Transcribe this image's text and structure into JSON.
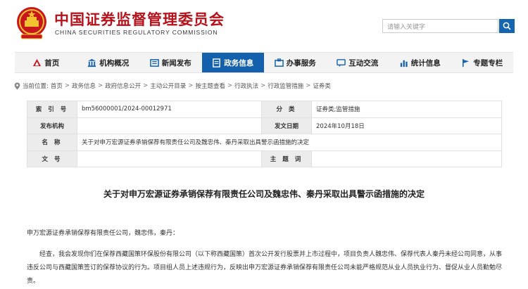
{
  "header": {
    "title": "中国证券监督管理委员会",
    "subtitle": "CHINA SECURITIES REGULATORY COMMISSION",
    "search_placeholder": "请输入关键字"
  },
  "nav": [
    {
      "label": "首页",
      "icon": "home-icon"
    },
    {
      "label": "机构概况",
      "icon": "building-icon"
    },
    {
      "label": "新闻发布",
      "icon": "news-icon"
    },
    {
      "label": "政务信息",
      "icon": "document-icon"
    },
    {
      "label": "办事服务",
      "icon": "service-icon"
    },
    {
      "label": "互动交流",
      "icon": "chat-icon"
    },
    {
      "label": "统计信息",
      "icon": "stats-icon"
    },
    {
      "label": "专题专栏",
      "icon": "flag-icon"
    }
  ],
  "breadcrumb": {
    "prefix": "当前位置:",
    "items": [
      "首页",
      "政务信息",
      "政府信息公开",
      "主动公开目录",
      "按主题查看",
      "行政执法",
      "行政监管措施",
      "证券类"
    ]
  },
  "info": {
    "index_label": "索 引 号",
    "index_value": "bm56000001/2024-00012971",
    "category_label": "分 类",
    "category_value": "证券类;监管措施",
    "org_label": "发布机构",
    "org_value": "",
    "date_label": "发文日期",
    "date_value": "2024年10月18日",
    "name_label": "名 称",
    "name_value": "关于对申万宏源证券承销保荐有限责任公司及魏忠伟、秦丹采取出具警示函措施的决定",
    "docno_label": "文 号",
    "docno_value": "",
    "keyword_label": "主 题 词",
    "keyword_value": ""
  },
  "document": {
    "title": "关于对申万宏源证券承销保荐有限责任公司及魏忠伟、秦丹采取出具警示函措施的决定",
    "salutation": "申万宏源证券承销保荐有限责任公司，魏忠伟，秦丹：",
    "paragraph": "经查，我会发现你们在保荐西藏国策环保股份有限公司（以下称西藏国策）首次公开发行股票并上市过程中，项目负责人魏忠伟、保荐代表人秦丹未经公司同意，从事违反公司与西藏国策签订的保荐协议的行为。项目组人员上述违规行为，反映出申万宏源证券承销保荐有限责任公司未能严格规范从业人员执业行为、督促从业人员勤勉尽责。"
  },
  "colors": {
    "brand_red": "#b5121b",
    "nav_active": "#1361ad",
    "search_button": "#1565b0"
  },
  "active_nav_index": 3
}
